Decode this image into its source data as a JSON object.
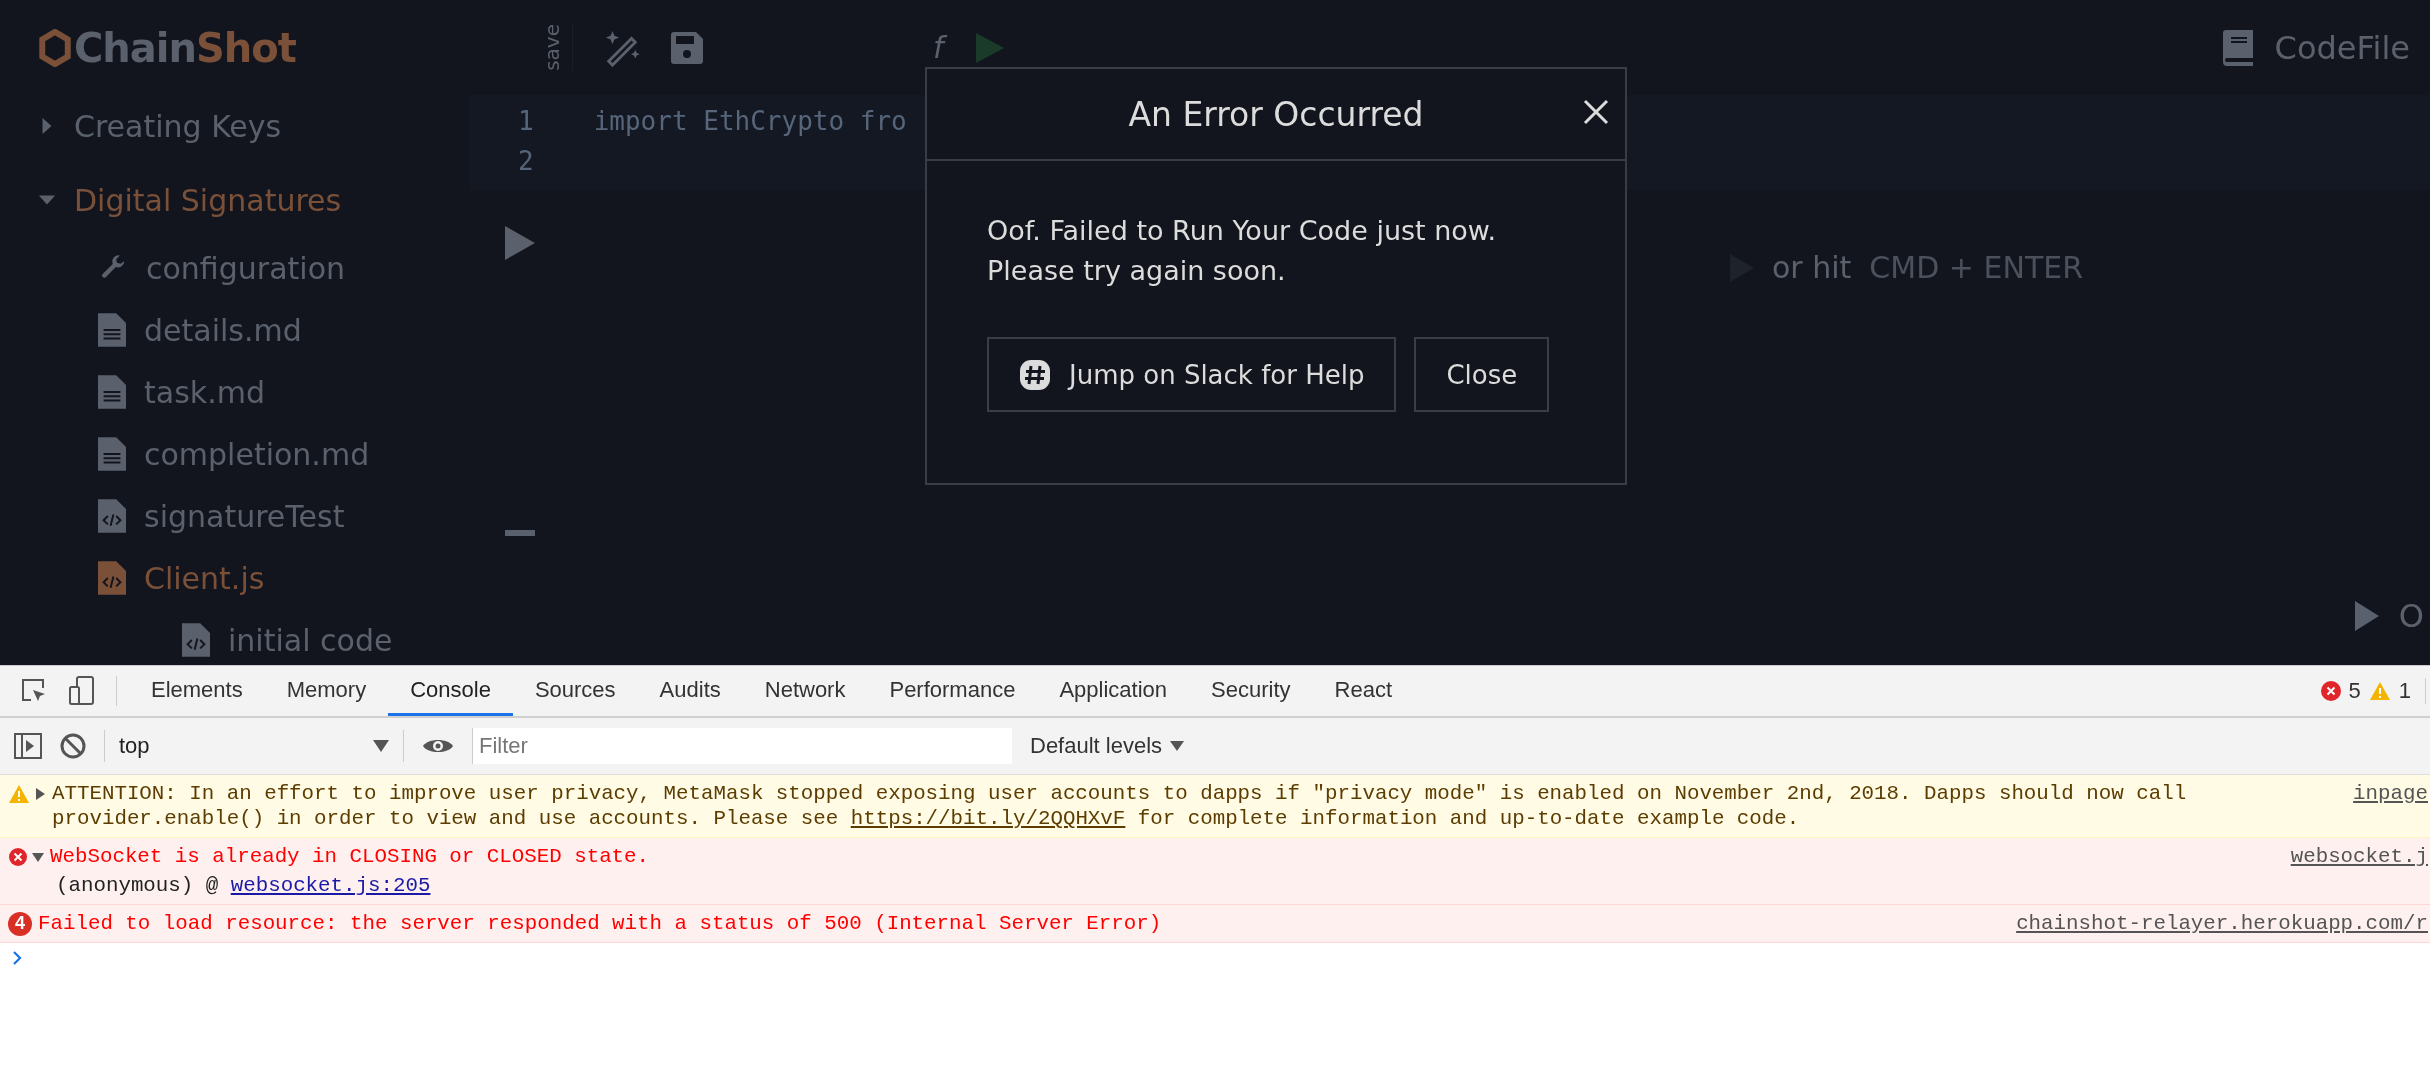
{
  "app": {
    "logo": {
      "first": "Chain",
      "second": "Shot"
    },
    "sidebar": {
      "items": [
        {
          "label": "Creating Keys",
          "kind": "section",
          "expanded": false,
          "selected": false
        },
        {
          "label": "Digital Signatures",
          "kind": "section",
          "expanded": true,
          "selected": true,
          "children": [
            {
              "label": "configuration",
              "kind": "config",
              "selected": false
            },
            {
              "label": "details.md",
              "kind": "doc",
              "selected": false
            },
            {
              "label": "task.md",
              "kind": "doc",
              "selected": false
            },
            {
              "label": "completion.md",
              "kind": "doc",
              "selected": false
            },
            {
              "label": "signatureTest",
              "kind": "code",
              "selected": false
            },
            {
              "label": "Client.js",
              "kind": "code",
              "selected": true,
              "children": [
                {
                  "label": "initial code",
                  "kind": "code",
                  "selected": false
                }
              ]
            }
          ]
        }
      ]
    },
    "editor": {
      "save_label": "save",
      "toolbar_label": "f",
      "line_numbers": [
        "1",
        "2"
      ],
      "code": "import EthCrypto fro",
      "hint": "or hit",
      "hint_keys": "CMD + ENTER",
      "file_label": "CodeFile",
      "corner_label": "O"
    }
  },
  "modal": {
    "title": "An Error Occurred",
    "message_1": "Oof. Failed to Run Your Code just now.",
    "message_2": "Please try again soon.",
    "buttons": [
      {
        "label": "Jump on Slack for Help",
        "kind": "slack"
      },
      {
        "label": "Close",
        "kind": "plain"
      }
    ]
  },
  "devtools": {
    "tabs": [
      {
        "label": "Elements",
        "selected": false
      },
      {
        "label": "Memory",
        "selected": false
      },
      {
        "label": "Console",
        "selected": true
      },
      {
        "label": "Sources",
        "selected": false
      },
      {
        "label": "Audits",
        "selected": false
      },
      {
        "label": "Network",
        "selected": false
      },
      {
        "label": "Performance",
        "selected": false
      },
      {
        "label": "Application",
        "selected": false
      },
      {
        "label": "Security",
        "selected": false
      },
      {
        "label": "React",
        "selected": false
      }
    ],
    "error_count": "5",
    "warning_count": "1",
    "context": "top",
    "filter": {
      "placeholder": "Filter"
    },
    "levels": "Default levels",
    "messages": [
      {
        "kind": "warning",
        "expanded": false,
        "text_before": "ATTENTION: In an effort to improve user privacy, MetaMask stopped exposing user accounts to dapps if \"privacy mode\" is enabled on November 2nd, 2018. Dapps should now call provider.enable() in order to view and use accounts. Please see ",
        "link": "https://bit.ly/2QQHXvF",
        "text_after": " for complete information and up-to-date example code.",
        "source": "inpage"
      },
      {
        "kind": "error",
        "expanded": true,
        "text_before": "WebSocket is already in CLOSING or CLOSED state.",
        "frames": [
          {
            "function": "(anonymous) @",
            "link": "websocket.js:205"
          }
        ],
        "source": "websocket.j"
      },
      {
        "kind": "error",
        "repeat": "4",
        "text_before": "Failed to load resource: the server responded with a status of 500 (Internal Server Error)",
        "source": "chainshot-relayer.herokuapp.com/r"
      }
    ]
  }
}
